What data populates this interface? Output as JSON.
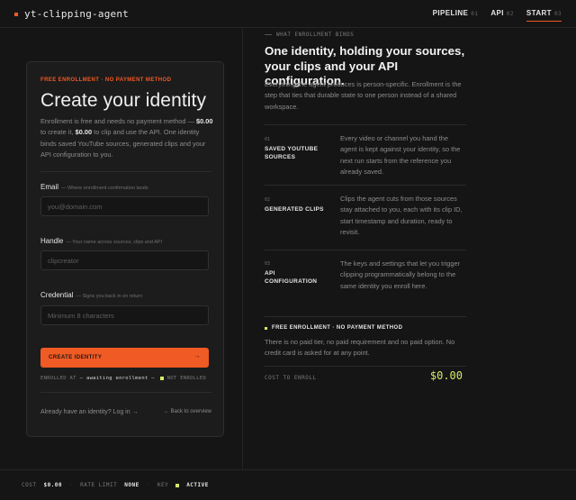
{
  "app": {
    "name": "yt-clipping-agent"
  },
  "nav": [
    {
      "label": "PIPELINE",
      "num": "01"
    },
    {
      "label": "API",
      "num": "02"
    },
    {
      "label": "START",
      "num": "03"
    }
  ],
  "card": {
    "tag": "FREE ENROLLMENT · NO PAYMENT METHOD",
    "title": "Create your identity",
    "desc_prefix": "Enrollment is free and needs no payment method — ",
    "desc_amount1": "$0.00",
    "desc_mid": " to create it, ",
    "desc_amount2": "$0.00",
    "desc_suffix": " to clip and use the API. One identity binds saved YouTube sources, generated clips and your API configuration to you.",
    "email": {
      "label": "Email",
      "hint": "— Where enrollment confirmation lands",
      "value": "",
      "placeholder": "you@domain.com"
    },
    "handle": {
      "label": "Handle",
      "hint": "— Your name across sources, clips and API",
      "value": "",
      "placeholder": "clipcreator"
    },
    "credential": {
      "label": "Credential",
      "hint": "— Signs you back in on return",
      "value": "",
      "placeholder": "Minimum 8 characters"
    },
    "cta_label": "CREATE IDENTITY",
    "cta_arrow": "→",
    "status": {
      "label": "ENROLLED AT",
      "value": "— awaiting enrollment —",
      "flag": "NOT ENROLLED"
    },
    "login_text": "Already have an identity? Log in →",
    "back_text": "← Back to overview"
  },
  "right": {
    "eyebrow": "WHAT ENROLLMENT BINDS",
    "title": "One identity, holding your sources, your clips and your API configuration.",
    "desc": "Everything the agent produces is person-specific. Enrollment is the step that ties that durable state to one person instead of a shared workspace.",
    "binds": [
      {
        "num": "01",
        "name": "SAVED YOUTUBE SOURCES",
        "desc": "Every video or channel you hand the agent is kept against your identity, so the next run starts from the reference you already saved."
      },
      {
        "num": "02",
        "name": "GENERATED CLIPS",
        "desc": "Clips the agent cuts from those sources stay attached to you, each with its clip ID, start timestamp and duration, ready to revisit."
      },
      {
        "num": "03",
        "name": "API CONFIGURATION",
        "desc": "The keys and settings that let you trigger clipping programmatically belong to the same identity you enroll here."
      }
    ],
    "enroll_tag": "FREE ENROLLMENT · NO PAYMENT METHOD",
    "enroll_desc": "There is no paid tier, no paid requirement and no paid option. No credit card is asked for at any point.",
    "cost_label": "COST TO ENROLL",
    "cost_value": "$0.00"
  },
  "footer": {
    "cost_label": "COST",
    "cost_value": "$0.00",
    "rate_label": "RATE LIMIT",
    "rate_value": "NONE",
    "key_label": "KEY",
    "key_value": "ACTIVE"
  },
  "colors": {
    "accent": "#f05a24",
    "highlight": "#d6e86a",
    "background": "#151515",
    "card": "#1c1c1c"
  }
}
